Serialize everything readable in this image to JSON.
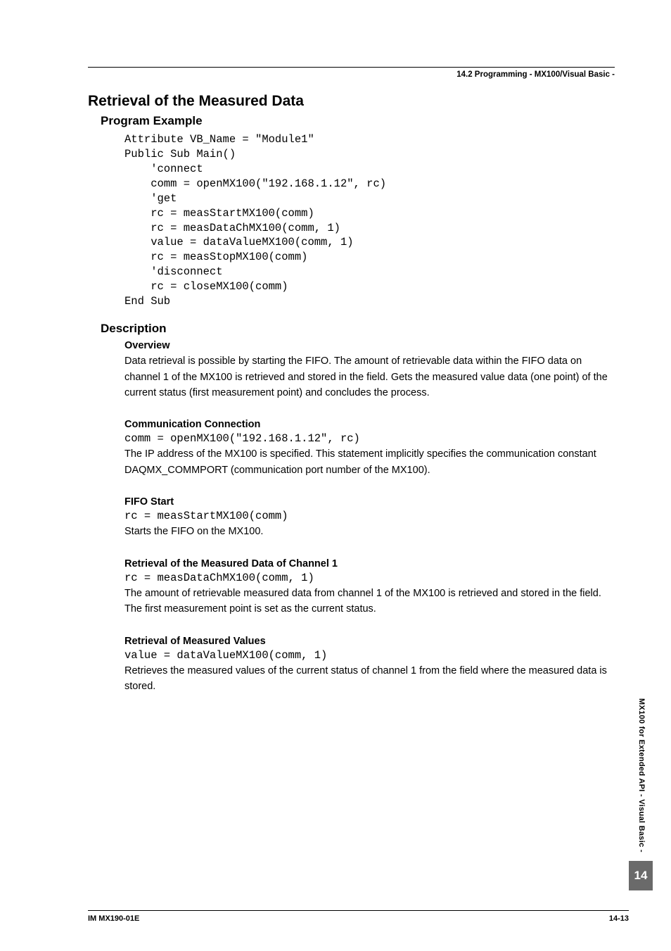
{
  "header": {
    "section_ref": "14.2  Programming - MX100/Visual Basic -"
  },
  "title": "Retrieval of the Measured Data",
  "program_example": {
    "heading": "Program Example",
    "code": "Attribute VB_Name = \"Module1\"\nPublic Sub Main()\n    'connect\n    comm = openMX100(\"192.168.1.12\", rc)\n    'get\n    rc = measStartMX100(comm)\n    rc = measDataChMX100(comm, 1)\n    value = dataValueMX100(comm, 1)\n    rc = measStopMX100(comm)\n    'disconnect\n    rc = closeMX100(comm)\nEnd Sub"
  },
  "description": {
    "heading": "Description",
    "sections": [
      {
        "title": "Overview",
        "code": "",
        "body": "Data retrieval is possible by starting the FIFO. The amount of retrievable data within the FIFO data on channel 1 of the MX100 is retrieved and stored in the field. Gets the measured value data (one point) of the current status (first measurement point) and concludes the process."
      },
      {
        "title": "Communication Connection",
        "code": "comm = openMX100(\"192.168.1.12\", rc)",
        "body": "The IP address of the MX100 is specified. This statement implicitly specifies the communication constant DAQMX_COMMPORT (communication port number of the MX100)."
      },
      {
        "title": "FIFO Start",
        "code": "rc = measStartMX100(comm)",
        "body": "Starts the FIFO on the MX100."
      },
      {
        "title": "Retrieval of the Measured Data of Channel 1",
        "code": "rc = measDataChMX100(comm, 1)",
        "body": "The amount of retrievable measured data from channel 1 of the MX100 is retrieved and stored in the field. The first measurement point is set as the current status."
      },
      {
        "title": "Retrieval of Measured Values",
        "code": "value = dataValueMX100(comm, 1)",
        "body": "Retrieves the measured values of the current status of channel 1 from the field where the measured data is stored."
      }
    ]
  },
  "side": {
    "tab_text": "MX100 for Extended API - Visual Basic -",
    "badge": "14"
  },
  "footer": {
    "left": "IM MX190-01E",
    "right": "14-13"
  }
}
